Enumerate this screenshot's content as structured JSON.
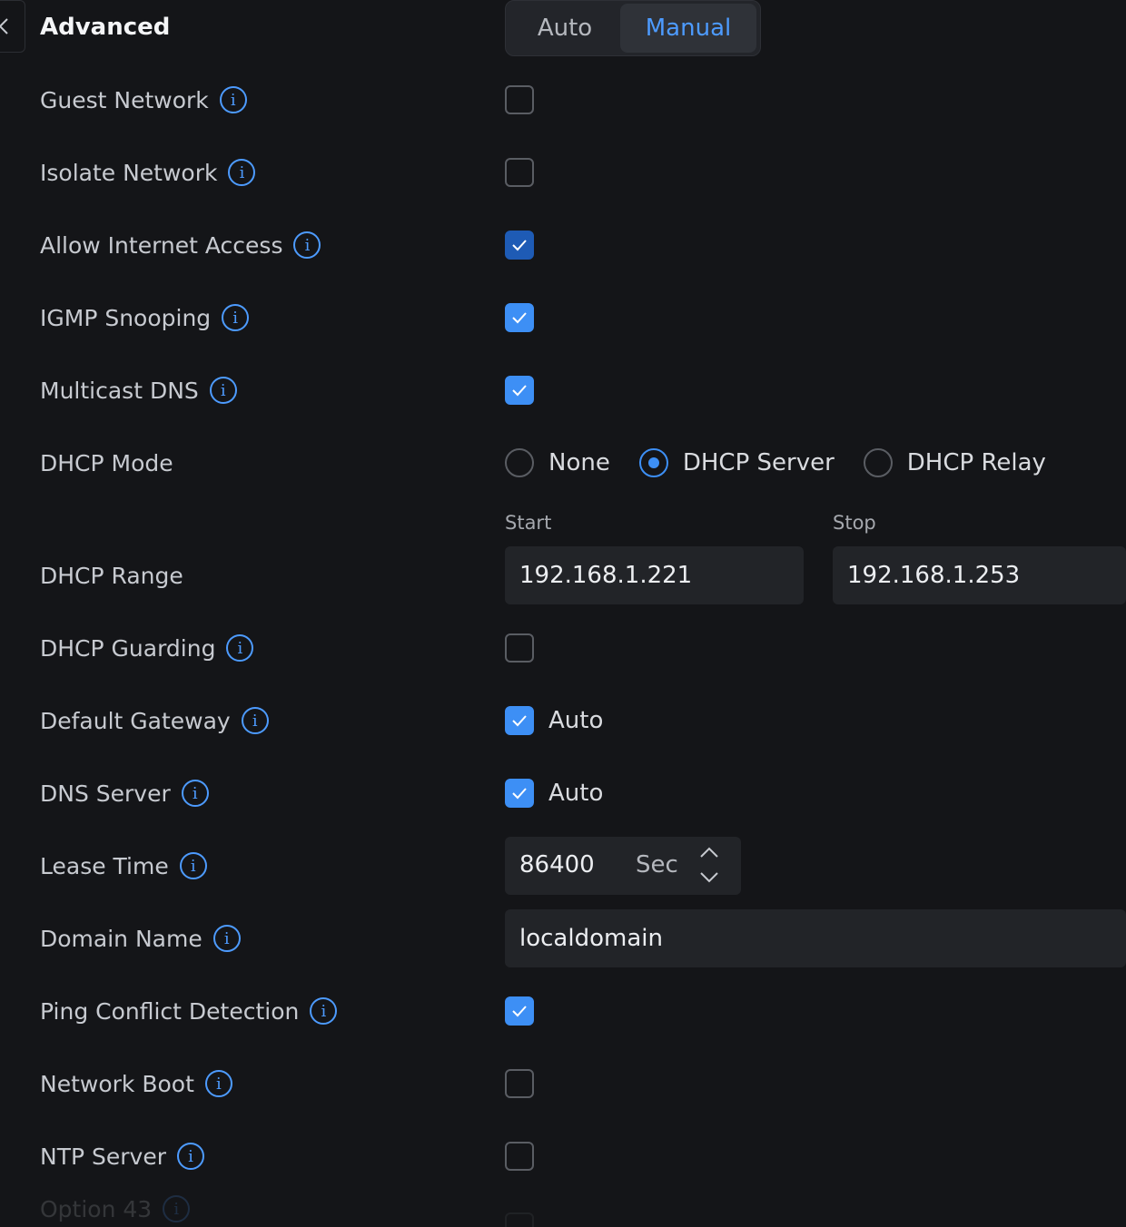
{
  "header": {
    "title": "Advanced",
    "mode_options": [
      "Auto",
      "Manual"
    ],
    "mode_selected": "Manual"
  },
  "settings": {
    "guest_network": {
      "label": "Guest Network",
      "checked": false
    },
    "isolate_network": {
      "label": "Isolate Network",
      "checked": false
    },
    "allow_internet_access": {
      "label": "Allow Internet Access",
      "checked": true
    },
    "igmp_snooping": {
      "label": "IGMP Snooping",
      "checked": true
    },
    "multicast_dns": {
      "label": "Multicast DNS",
      "checked": true
    },
    "dhcp_mode": {
      "label": "DHCP Mode",
      "options": [
        "None",
        "DHCP Server",
        "DHCP Relay"
      ],
      "selected": "DHCP Server"
    },
    "dhcp_range": {
      "label": "DHCP Range",
      "start_label": "Start",
      "start_value": "192.168.1.221",
      "stop_label": "Stop",
      "stop_value": "192.168.1.253"
    },
    "dhcp_guarding": {
      "label": "DHCP Guarding",
      "checked": false
    },
    "default_gateway": {
      "label": "Default Gateway",
      "checked": true,
      "option_label": "Auto"
    },
    "dns_server": {
      "label": "DNS Server",
      "checked": true,
      "option_label": "Auto"
    },
    "lease_time": {
      "label": "Lease Time",
      "value": "86400",
      "unit": "Sec"
    },
    "domain_name": {
      "label": "Domain Name",
      "value": "localdomain"
    },
    "ping_conflict_detection": {
      "label": "Ping Conflict Detection",
      "checked": true
    },
    "network_boot": {
      "label": "Network Boot",
      "checked": false
    },
    "ntp_server": {
      "label": "NTP Server",
      "checked": false
    },
    "option_43": {
      "label": "Option 43",
      "checked": false
    }
  },
  "icons": {
    "info": "i",
    "back": "chevron-left-icon",
    "check": "checkmark-icon"
  },
  "colors": {
    "background": "#141518",
    "accent": "#3d8ff5",
    "info_icon": "#4d9bff",
    "input_bg": "#222428"
  }
}
